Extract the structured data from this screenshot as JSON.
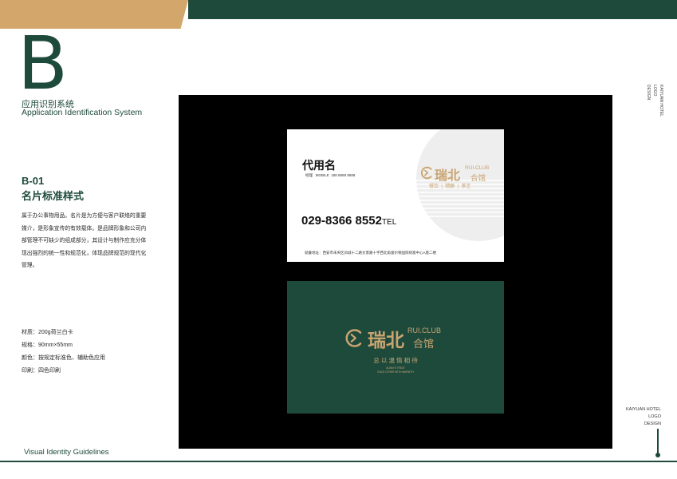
{
  "header": {
    "section_letter": "B",
    "system_cn": "应用识别系统",
    "system_en": "Application Identification System"
  },
  "section": {
    "code": "B-01",
    "title": "名片标准样式"
  },
  "description": "属于办公事物用品。名片是为方便与客户联络的重要媒介，是形象宣传的有效载体。是品牌形象和公司内部管理不可缺少的组成部分，其设计与制作应充分体现出强烈的统一性和规范化，体现品牌规范的现代化管理。",
  "specs": [
    "材质：200g荷兰白卡",
    "规格：90mm×55mm",
    "颜色：按规定标准色、辅助色应用",
    "印刷：四色印刷"
  ],
  "footer": "Visual Identity Guidelines",
  "vertical_label": [
    "KAIYUAN HOTEL",
    "LOGO",
    "DESIGN"
  ],
  "brand_mark": [
    "KAIYUAN HOTEL",
    "LOGO",
    "DESIGN"
  ],
  "card_front": {
    "name": "代用名",
    "role": "经理",
    "mobile_label": "MOBILE",
    "mobile": "188 8888 8888",
    "phone": "029-8366 8552",
    "phone_label": "TEL",
    "address": "就餐地址：西安市未央区凤城十二路文景路十字西北角富尔顿国际财富中心A座二楼",
    "logo_cn": "瑞北",
    "logo_en": "RUI.CLUB",
    "logo_cn2": "合馆",
    "tagline_items": [
      "餐饮",
      "精酿",
      "茶艺"
    ]
  },
  "card_back": {
    "logo_cn": "瑞北",
    "logo_en": "RUI.CLUB",
    "logo_cn2": "合馆",
    "slogan": "总 以 温 情 相 待",
    "slogan_en_1": "ALWAYS TREAT",
    "slogan_en_2": "EACH OTHER WITH WARMTH"
  },
  "colors": {
    "brand_green": "#1e4a3c",
    "brand_gold": "#d3a66c",
    "logo_gold": "#c9a470"
  }
}
